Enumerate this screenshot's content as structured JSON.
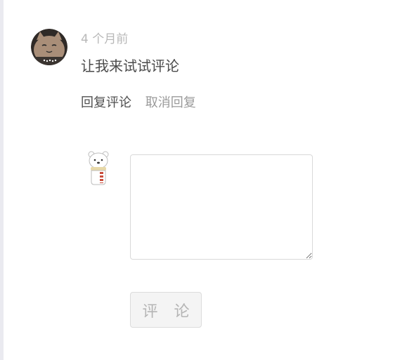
{
  "comment": {
    "author_avatar": "cat-avatar-icon",
    "timestamp": "4 个月前",
    "text": "让我来试试评论"
  },
  "actions": {
    "reply_label": "回复评论",
    "cancel_label": "取消回复"
  },
  "reply_form": {
    "user_avatar": "polar-bear-avatar-icon",
    "textarea_value": "",
    "submit_label": "评 论"
  },
  "colors": {
    "muted_text": "#b8b8b8",
    "body_text": "#4a4a4a",
    "button_bg": "#f4f4f4",
    "border": "#d9d9d9"
  }
}
